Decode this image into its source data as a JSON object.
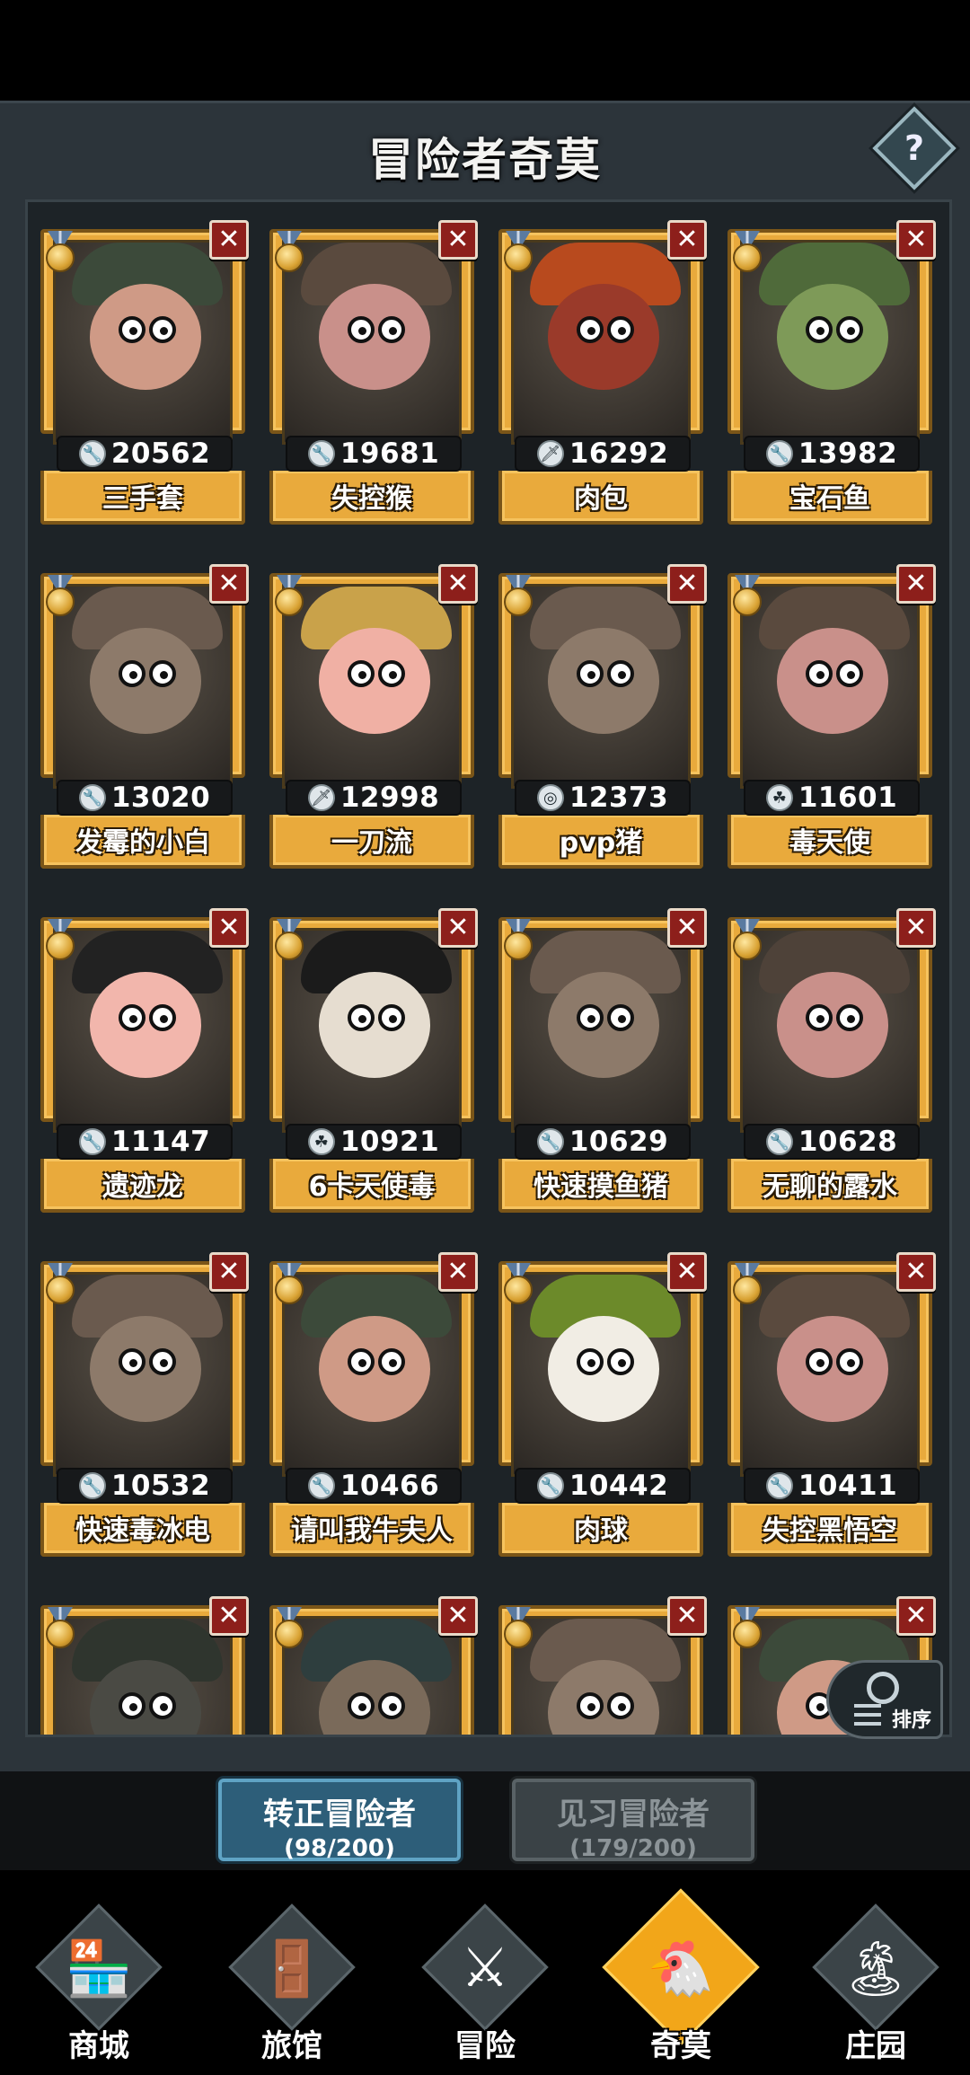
{
  "header": {
    "title": "冒险者奇莫",
    "help_symbol": "?"
  },
  "cards": [
    {
      "name": "三手套",
      "power": "20562",
      "power_icon": "wrench-icon",
      "skin": "#cf9a86",
      "cap": "#3c4a3a"
    },
    {
      "name": "失控猴",
      "power": "19681",
      "power_icon": "wrench-icon",
      "skin": "#c9908a",
      "cap": "#5a4a3e"
    },
    {
      "name": "肉包",
      "power": "16292",
      "power_icon": "sword-icon",
      "skin": "#9a3a2a",
      "cap": "#b84a1e"
    },
    {
      "name": "宝石鱼",
      "power": "13982",
      "power_icon": "wrench-icon",
      "skin": "#7e9a58",
      "cap": "#4f6a3a"
    },
    {
      "name": "发霉的小白",
      "power": "13020",
      "power_icon": "wrench-icon",
      "skin": "#8d7a6a",
      "cap": "#6a5a4e"
    },
    {
      "name": "一刀流",
      "power": "12998",
      "power_icon": "sword-icon",
      "skin": "#f0b0a4",
      "cap": "#c9a24a"
    },
    {
      "name": "pvp猪",
      "power": "12373",
      "power_icon": "target-icon",
      "skin": "#8d7a6a",
      "cap": "#6a5a4e"
    },
    {
      "name": "毒天使",
      "power": "11601",
      "power_icon": "leaf-icon",
      "skin": "#c9908a",
      "cap": "#5a4a3e"
    },
    {
      "name": "遗迹龙",
      "power": "11147",
      "power_icon": "wrench-icon",
      "skin": "#f2b6ac",
      "cap": "#222222"
    },
    {
      "name": "6卡天使毒",
      "power": "10921",
      "power_icon": "leaf-icon",
      "skin": "#e6ddd0",
      "cap": "#1b1b1b"
    },
    {
      "name": "快速摸鱼猪",
      "power": "10629",
      "power_icon": "wrench-icon",
      "skin": "#8d7a6a",
      "cap": "#6a5a4e"
    },
    {
      "name": "无聊的露水",
      "power": "10628",
      "power_icon": "wrench-icon",
      "skin": "#c9908a",
      "cap": "#4e4239"
    },
    {
      "name": "快速毒冰电",
      "power": "10532",
      "power_icon": "wrench-icon",
      "skin": "#8d7a6a",
      "cap": "#6a5a4e"
    },
    {
      "name": "请叫我牛夫人",
      "power": "10466",
      "power_icon": "wrench-icon",
      "skin": "#cf9a86",
      "cap": "#3c4a3a"
    },
    {
      "name": "肉球",
      "power": "10442",
      "power_icon": "wrench-icon",
      "skin": "#f1ede4",
      "cap": "#6c8a2a"
    },
    {
      "name": "失控黑悟空",
      "power": "10411",
      "power_icon": "wrench-icon",
      "skin": "#c9908a",
      "cap": "#5a4a3e"
    },
    {
      "skin": "#4a4a44",
      "cap": "#2f352e"
    },
    {
      "skin": "#7a6a5a",
      "cap": "#2e3e3e"
    },
    {
      "skin": "#8d7a6a",
      "cap": "#6a5a4e"
    },
    {
      "skin": "#cf9a86",
      "cap": "#3c4a3a"
    }
  ],
  "sort": {
    "label": "排序"
  },
  "tabs": [
    {
      "label": "转正冒险者",
      "count": "(98/200)"
    },
    {
      "label": "见习冒险者",
      "count": "(179/200)"
    }
  ],
  "nav": [
    {
      "label": "商城",
      "icon": "shop-icon",
      "glyph": "🏪"
    },
    {
      "label": "旅馆",
      "icon": "inn-gate-icon",
      "glyph": "🚪"
    },
    {
      "label": "冒险",
      "icon": "crossed-swords-icon",
      "glyph": "⚔"
    },
    {
      "label": "奇莫",
      "icon": "chimo-mascot-icon",
      "glyph": "🐔"
    },
    {
      "label": "庄园",
      "icon": "manor-island-icon",
      "glyph": "🏝"
    }
  ],
  "icon_glyphs": {
    "wrench-icon": "🔧",
    "sword-icon": "🗡",
    "target-icon": "◎",
    "leaf-icon": "☘"
  }
}
